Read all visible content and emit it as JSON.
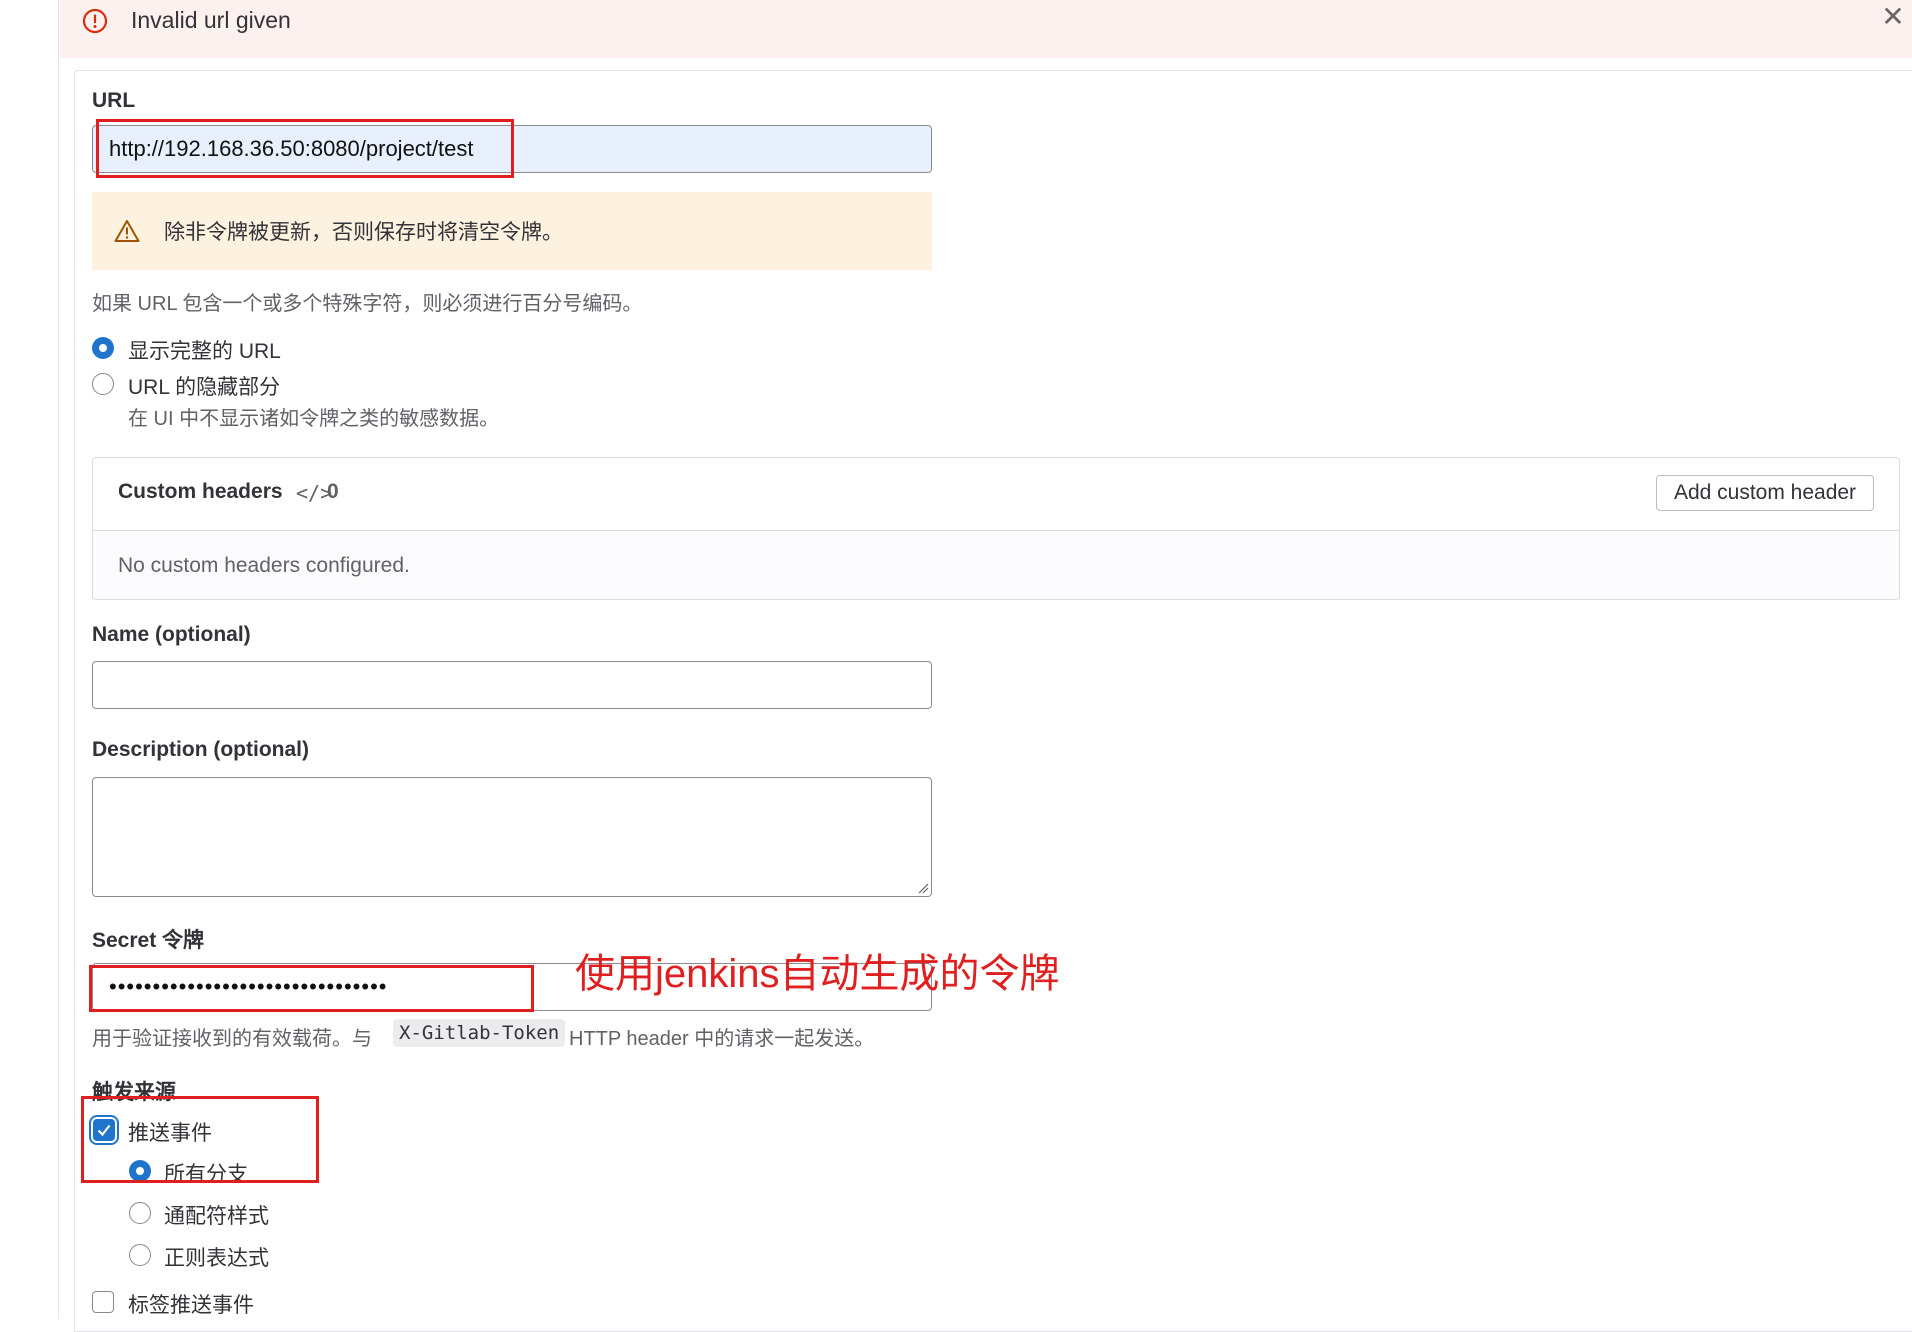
{
  "alert": {
    "message": "Invalid url given",
    "icon": "error-circle-icon",
    "close_icon": "close-icon"
  },
  "url": {
    "label": "URL",
    "value": "http://192.168.36.50:8080/project/test",
    "warning": "除非令牌被更新，否则保存时将清空令牌。",
    "help": "如果 URL 包含一个或多个特殊字符，则必须进行百分号编码。",
    "display_options": [
      {
        "label": "显示完整的 URL",
        "selected": true
      },
      {
        "label": "URL 的隐藏部分",
        "selected": false,
        "description": "在 UI 中不显示诸如令牌之类的敏感数据。"
      }
    ]
  },
  "custom_headers": {
    "title": "Custom headers",
    "count": "0",
    "add_button": "Add custom header",
    "empty_message": "No custom headers configured."
  },
  "name": {
    "label": "Name (optional)",
    "value": ""
  },
  "description": {
    "label": "Description (optional)",
    "value": ""
  },
  "secret": {
    "label": "Secret 令牌",
    "masked_value": "••••••••••••••••••••••••••••••••",
    "help_prefix": "用于验证接收到的有效载荷。与",
    "help_code": "X-Gitlab-Token",
    "help_suffix": "HTTP header 中的请求一起发送。"
  },
  "triggers": {
    "title": "触发来源",
    "push_events": {
      "label": "推送事件",
      "checked": true
    },
    "branch_options": [
      {
        "label": "所有分支",
        "selected": true
      },
      {
        "label": "通配符样式",
        "selected": false
      },
      {
        "label": "正则表达式",
        "selected": false
      }
    ],
    "tag_push_events": {
      "label": "标签推送事件",
      "checked": false
    }
  },
  "annotation": {
    "text": "使用jenkins自动生成的令牌",
    "color": "#e02020"
  },
  "colors": {
    "accent": "#1f75cb",
    "danger": "#dd2b0e",
    "alert_bg": "#fdf1ef",
    "warning_bg": "#fdf1df"
  }
}
